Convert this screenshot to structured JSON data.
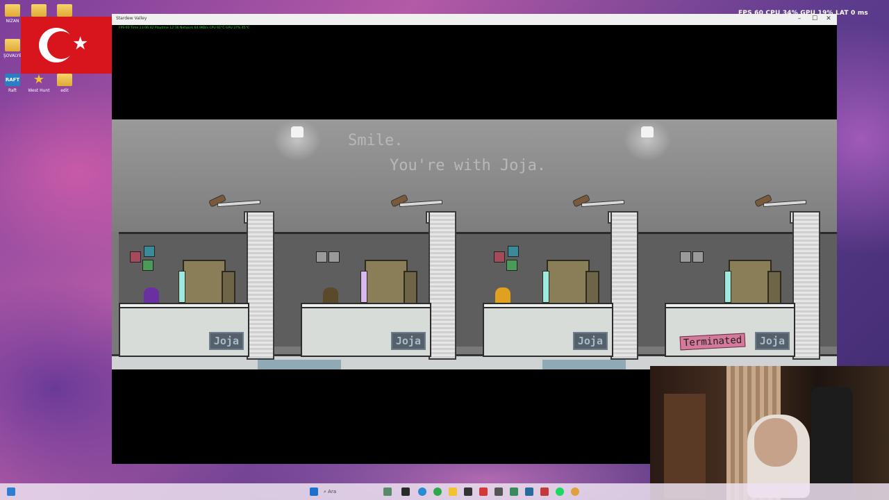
{
  "desktop": {
    "icons": [
      {
        "label": "NIZAN",
        "icon": "folder-icon"
      },
      {
        "label": "",
        "icon": "folder-icon"
      },
      {
        "label": "",
        "icon": "folder-icon"
      },
      {
        "label": "ŞOVALYE",
        "icon": "folder-icon"
      },
      {
        "label": "Raft",
        "icon": "raft-icon"
      },
      {
        "label": "West Hunt",
        "icon": "sheriff-star-icon"
      },
      {
        "label": "edit",
        "icon": "folder-icon"
      }
    ],
    "flag": "turkish-flag"
  },
  "overlay": {
    "fps_text": "FPS 60 CPU 34% GPU 19% LAT 0 ms"
  },
  "window": {
    "title": "Stardew Valley",
    "controls": {
      "minimize": "–",
      "maximize": "☐",
      "close": "✕"
    },
    "stats_line": "FPS 60   Time 23:06:42   Playtime 12:36   Network 64.9KB/s   CPU 61°C   GPU 27% 45°C"
  },
  "scene": {
    "slogan_line1": "Smile.",
    "slogan_line2": "You're with Joja.",
    "desk_brand": "Joja",
    "terminated_sign": "Terminated",
    "cubicles": [
      {
        "worker_color": "#6a2fa0",
        "has_notes": true
      },
      {
        "worker_color": "#5a4a2a",
        "has_notes": true
      },
      {
        "worker_color": "#e0a020",
        "has_notes": true
      },
      {
        "worker_color": "",
        "has_notes": true,
        "terminated": true
      }
    ]
  },
  "taskbar": {
    "search_placeholder": "Ara",
    "icons": [
      "windows-start-icon",
      "search-icon",
      "task-view-icon",
      "file-explorer-icon",
      "edge-icon",
      "chrome-icon",
      "folder-icon",
      "app-icon",
      "app-icon",
      "app-icon",
      "app-icon",
      "app-icon",
      "app-icon",
      "spotify-icon",
      "app-icon"
    ]
  },
  "colors": {
    "overlay_green": "#27d627",
    "terminated_pink": "#d3799a",
    "joja_blue": "#a9bccb"
  }
}
